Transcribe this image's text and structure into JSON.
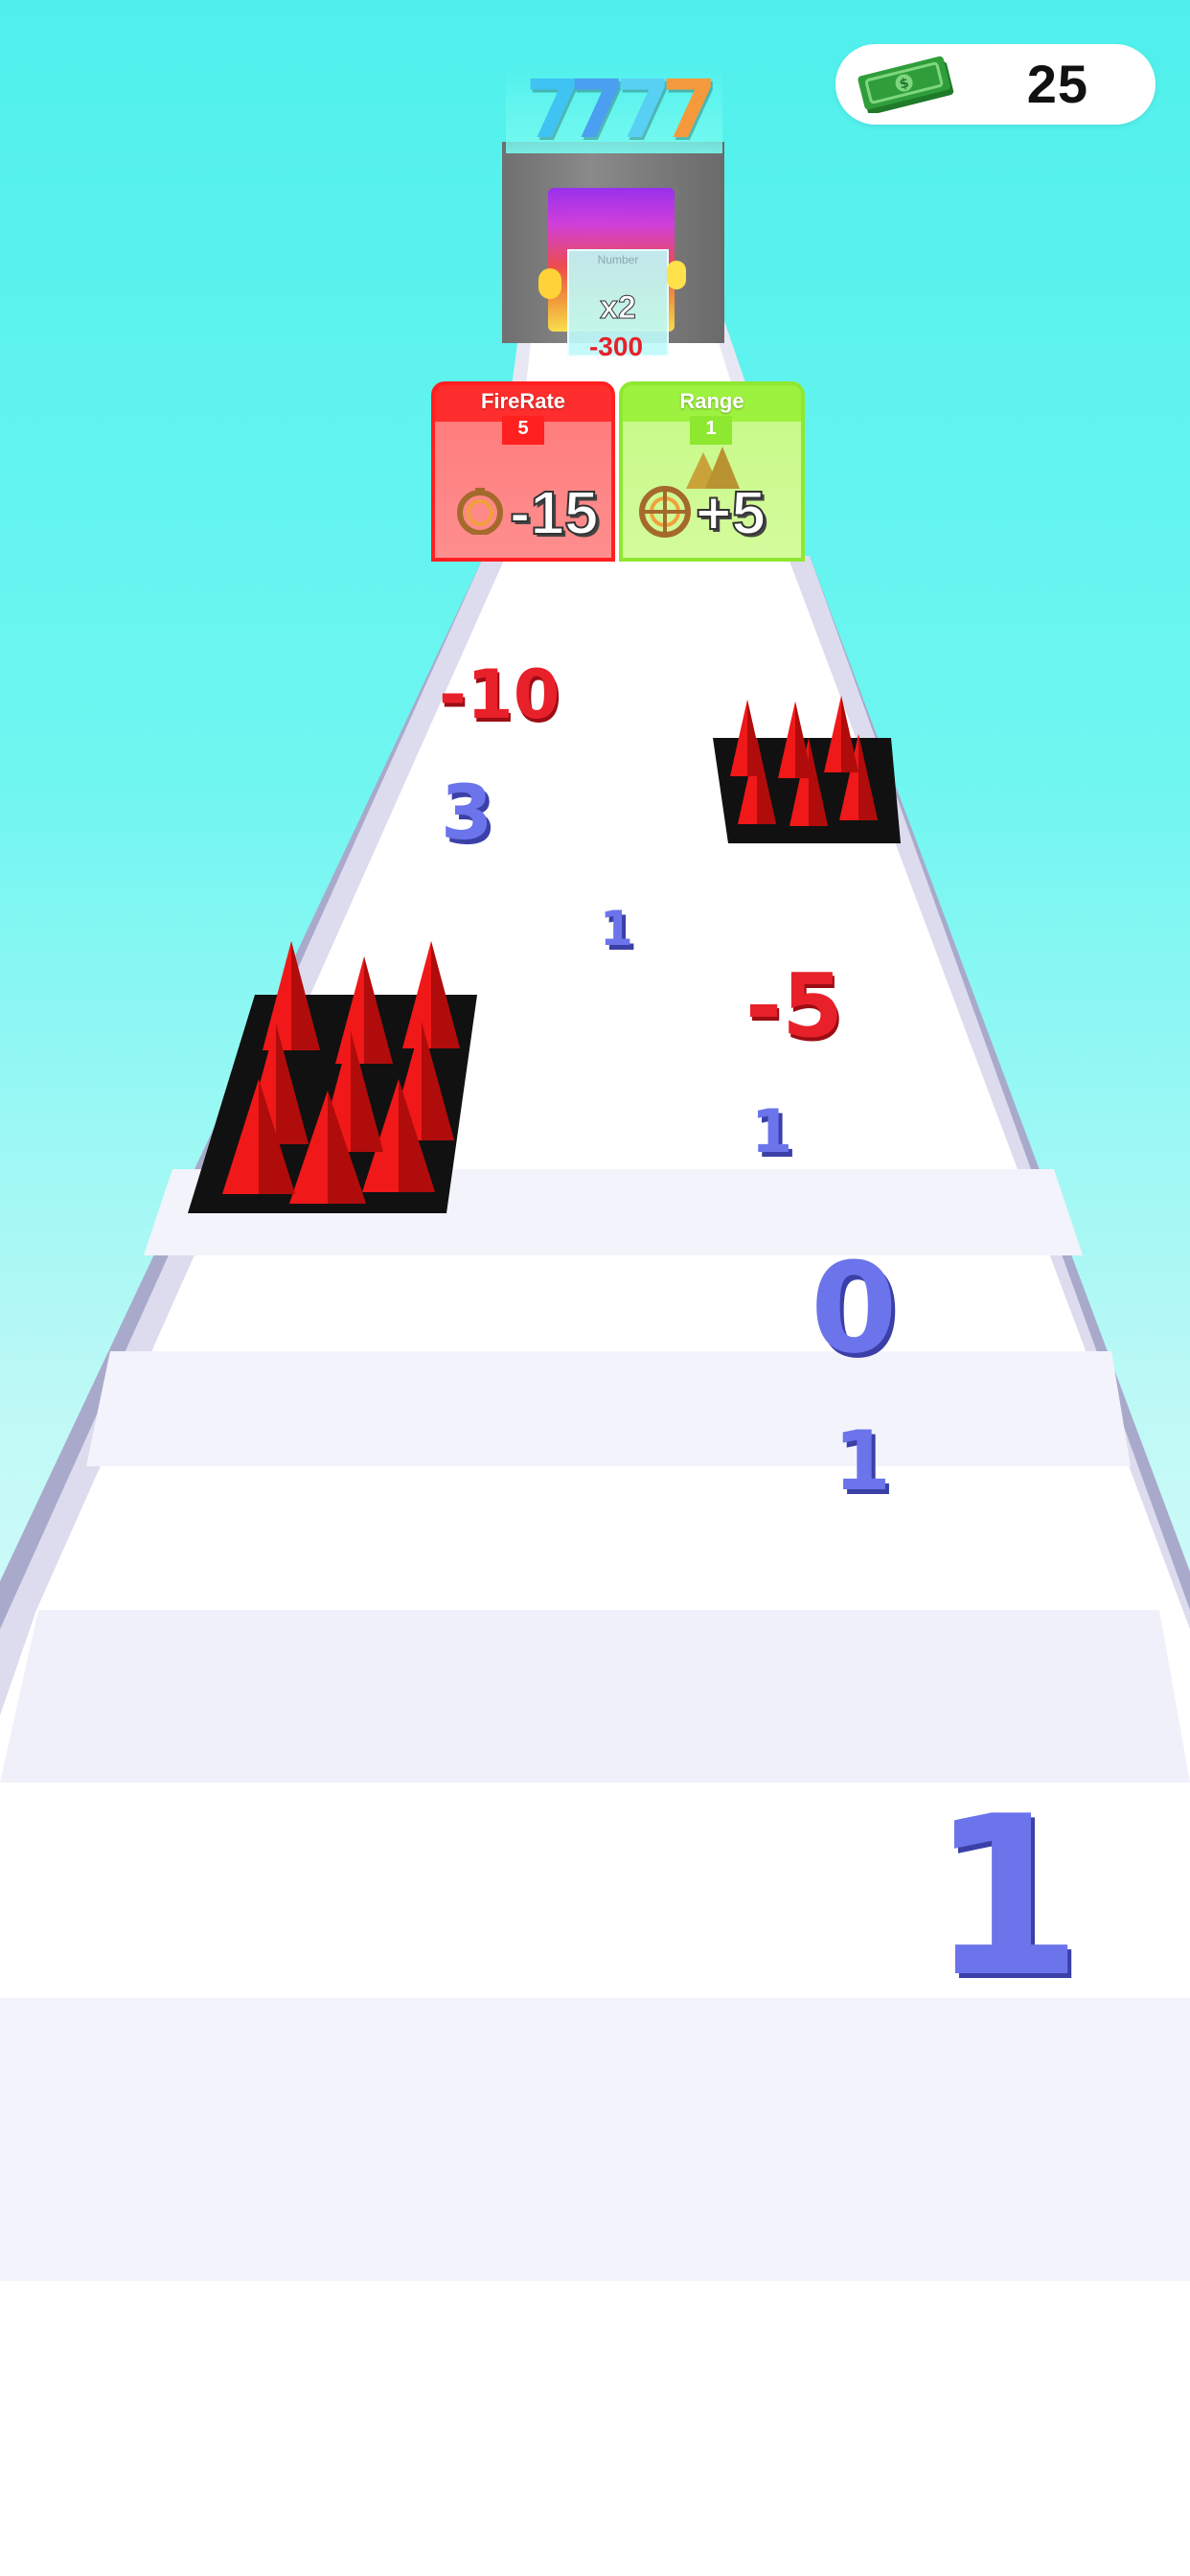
{
  "hud": {
    "money_icon": "cash-bill-icon",
    "money": "25"
  },
  "tower": {
    "digits": [
      "7",
      "7",
      "7",
      "7"
    ],
    "digit_colors": [
      "#3fc3f2",
      "#4a9ff0",
      "#58d0f4",
      "#f59a3c"
    ]
  },
  "bonus_gate": {
    "label": "Number",
    "value": "x2",
    "cost": "-300"
  },
  "gates": [
    {
      "label": "FireRate",
      "level": "5",
      "icon": "stopwatch-icon",
      "value": "-15",
      "color": "#ff3b3b"
    },
    {
      "label": "Range",
      "level": "1",
      "icon": "crosshair-icon",
      "value": "+5",
      "color": "#a6f54a"
    }
  ],
  "numbers": {
    "n1": "-10",
    "n2": "3",
    "n3": "1",
    "n4": "-5",
    "n5": "1",
    "n6": "0",
    "n7": "1",
    "n8": "1"
  },
  "colors": {
    "sky": "#4ff0ec",
    "track": "#ffffff",
    "rail": "#b9b9d9",
    "spike": "#f01818",
    "positive_number": "#6b74ea",
    "negative_number": "#e8202a"
  }
}
